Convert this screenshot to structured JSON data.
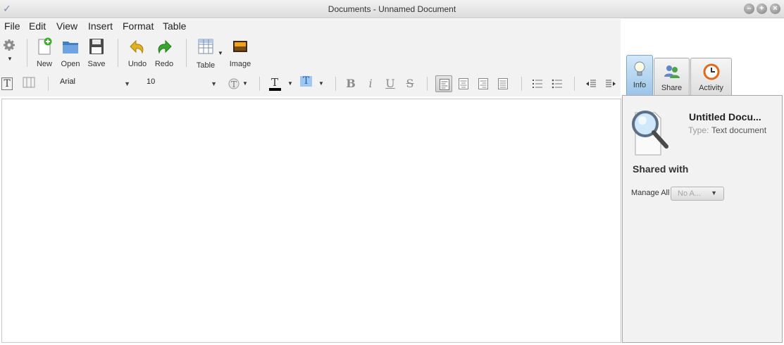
{
  "window": {
    "title": "Documents - Unnamed Document"
  },
  "menu": {
    "items": [
      "File",
      "Edit",
      "View",
      "Insert",
      "Format",
      "Table"
    ]
  },
  "toolbar": {
    "new": "New",
    "open": "Open",
    "save": "Save",
    "undo": "Undo",
    "redo": "Redo",
    "table": "Table",
    "image": "Image"
  },
  "format": {
    "font": "Arial",
    "size": "10"
  },
  "sidebar": {
    "tabs": [
      "Info",
      "Share",
      "Activity"
    ],
    "doc_title": "Untitled Docu...",
    "type_label": "Type:",
    "type_value": "Text document",
    "shared_heading": "Shared with",
    "manage_label": "Manage All",
    "manage_value": "No A..."
  },
  "colors": {
    "accent": "#9cc5ea",
    "panel_bg": "#f2f2f2"
  }
}
